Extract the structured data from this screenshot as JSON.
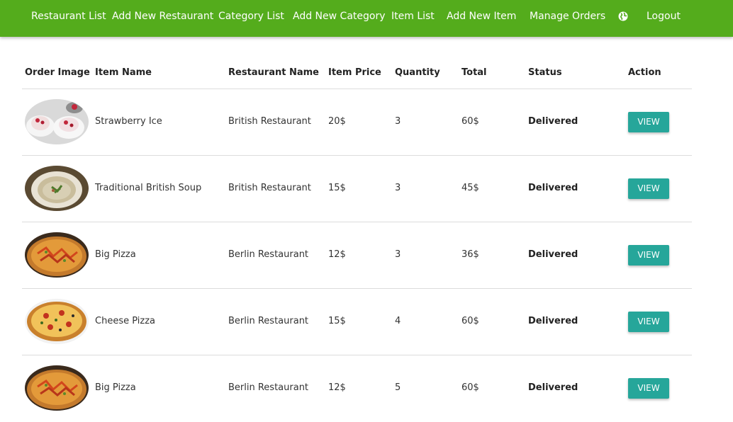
{
  "nav": {
    "items": [
      "Restaurant List",
      "Add New Restaurant",
      "Category List",
      "Add New Category",
      "Item List",
      "Add New Item",
      "Manage Orders"
    ],
    "language_icon": "globe-icon",
    "logout": "Logout"
  },
  "table": {
    "headers": [
      "Order Image",
      "Item Name",
      "Restaurant Name",
      "Item Price",
      "Quantity",
      "Total",
      "Status",
      "Action"
    ],
    "rows": [
      {
        "image": "strawberry-ice",
        "item": "Strawberry Ice",
        "restaurant": "British Restaurant",
        "price": "20$",
        "qty": "3",
        "total": "60$",
        "status": "Delivered",
        "action": "VIEW"
      },
      {
        "image": "british-soup",
        "item": "Traditional British Soup",
        "restaurant": "British Restaurant",
        "price": "15$",
        "qty": "3",
        "total": "45$",
        "status": "Delivered",
        "action": "VIEW"
      },
      {
        "image": "big-pizza",
        "item": "Big Pizza",
        "restaurant": "Berlin Restaurant",
        "price": "12$",
        "qty": "3",
        "total": "36$",
        "status": "Delivered",
        "action": "VIEW"
      },
      {
        "image": "cheese-pizza",
        "item": "Cheese Pizza",
        "restaurant": "Berlin Restaurant",
        "price": "15$",
        "qty": "4",
        "total": "60$",
        "status": "Delivered",
        "action": "VIEW"
      },
      {
        "image": "big-pizza",
        "item": "Big Pizza",
        "restaurant": "Berlin Restaurant",
        "price": "12$",
        "qty": "5",
        "total": "60$",
        "status": "Delivered",
        "action": "VIEW"
      }
    ]
  },
  "colors": {
    "navbar": "#54ac1c",
    "button": "#26a69a"
  }
}
